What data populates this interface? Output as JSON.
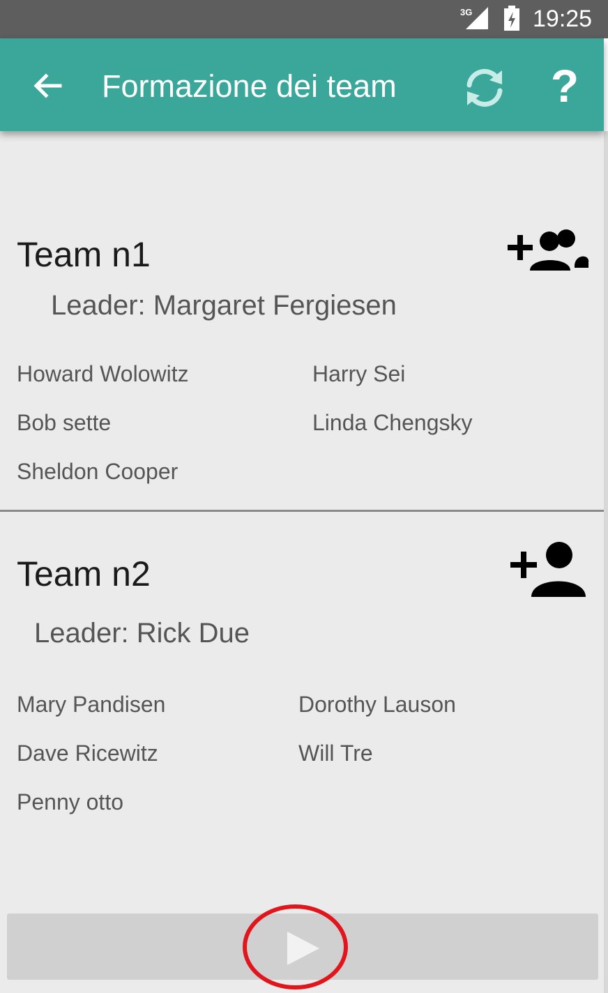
{
  "status_bar": {
    "network": "3G",
    "time": "19:25"
  },
  "app_bar": {
    "title": "Formazione dei team",
    "back_icon": "arrow-left-icon",
    "refresh_icon": "refresh-icon",
    "help_label": "?",
    "color": "#3aa79a"
  },
  "teams": [
    {
      "title": "Team n1",
      "leader": "Leader: Margaret Fergiesen",
      "action_icon": "group-add-icon",
      "members_left": [
        "Howard Wolowitz",
        "Bob sette",
        "Sheldon Cooper"
      ],
      "members_right": [
        "Harry Sei",
        "Linda Chengsky"
      ]
    },
    {
      "title": "Team n2",
      "leader": "Leader: Rick Due",
      "action_icon": "person-add-icon",
      "members_left": [
        "Mary Pandisen",
        "Dave Ricewitz",
        "Penny otto"
      ],
      "members_right": [
        "Dorothy Lauson",
        "Will Tre"
      ]
    }
  ],
  "bottom": {
    "play_icon": "play-icon",
    "highlight_color": "#e0161c"
  }
}
